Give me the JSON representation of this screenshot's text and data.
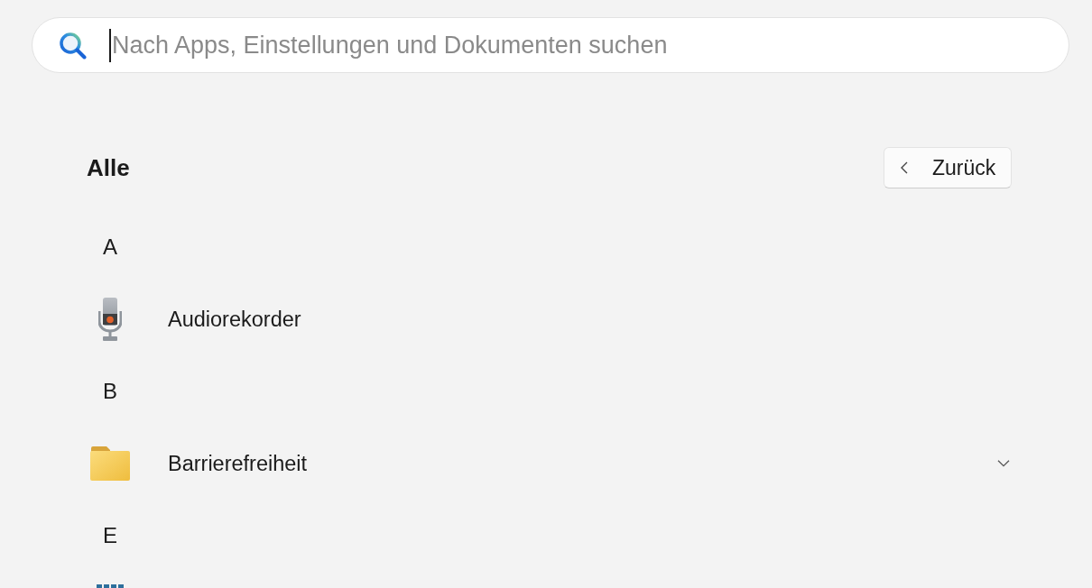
{
  "search": {
    "placeholder": "Nach Apps, Einstellungen und Dokumenten suchen"
  },
  "header": {
    "title": "Alle",
    "back_button": "Zurück"
  },
  "groups": [
    {
      "letter": "A",
      "items": [
        {
          "name": "Audiorekorder",
          "kind": "app"
        }
      ]
    },
    {
      "letter": "B",
      "items": [
        {
          "name": "Barrierefreiheit",
          "kind": "folder",
          "expanded": false
        }
      ]
    },
    {
      "letter": "E"
    }
  ]
}
